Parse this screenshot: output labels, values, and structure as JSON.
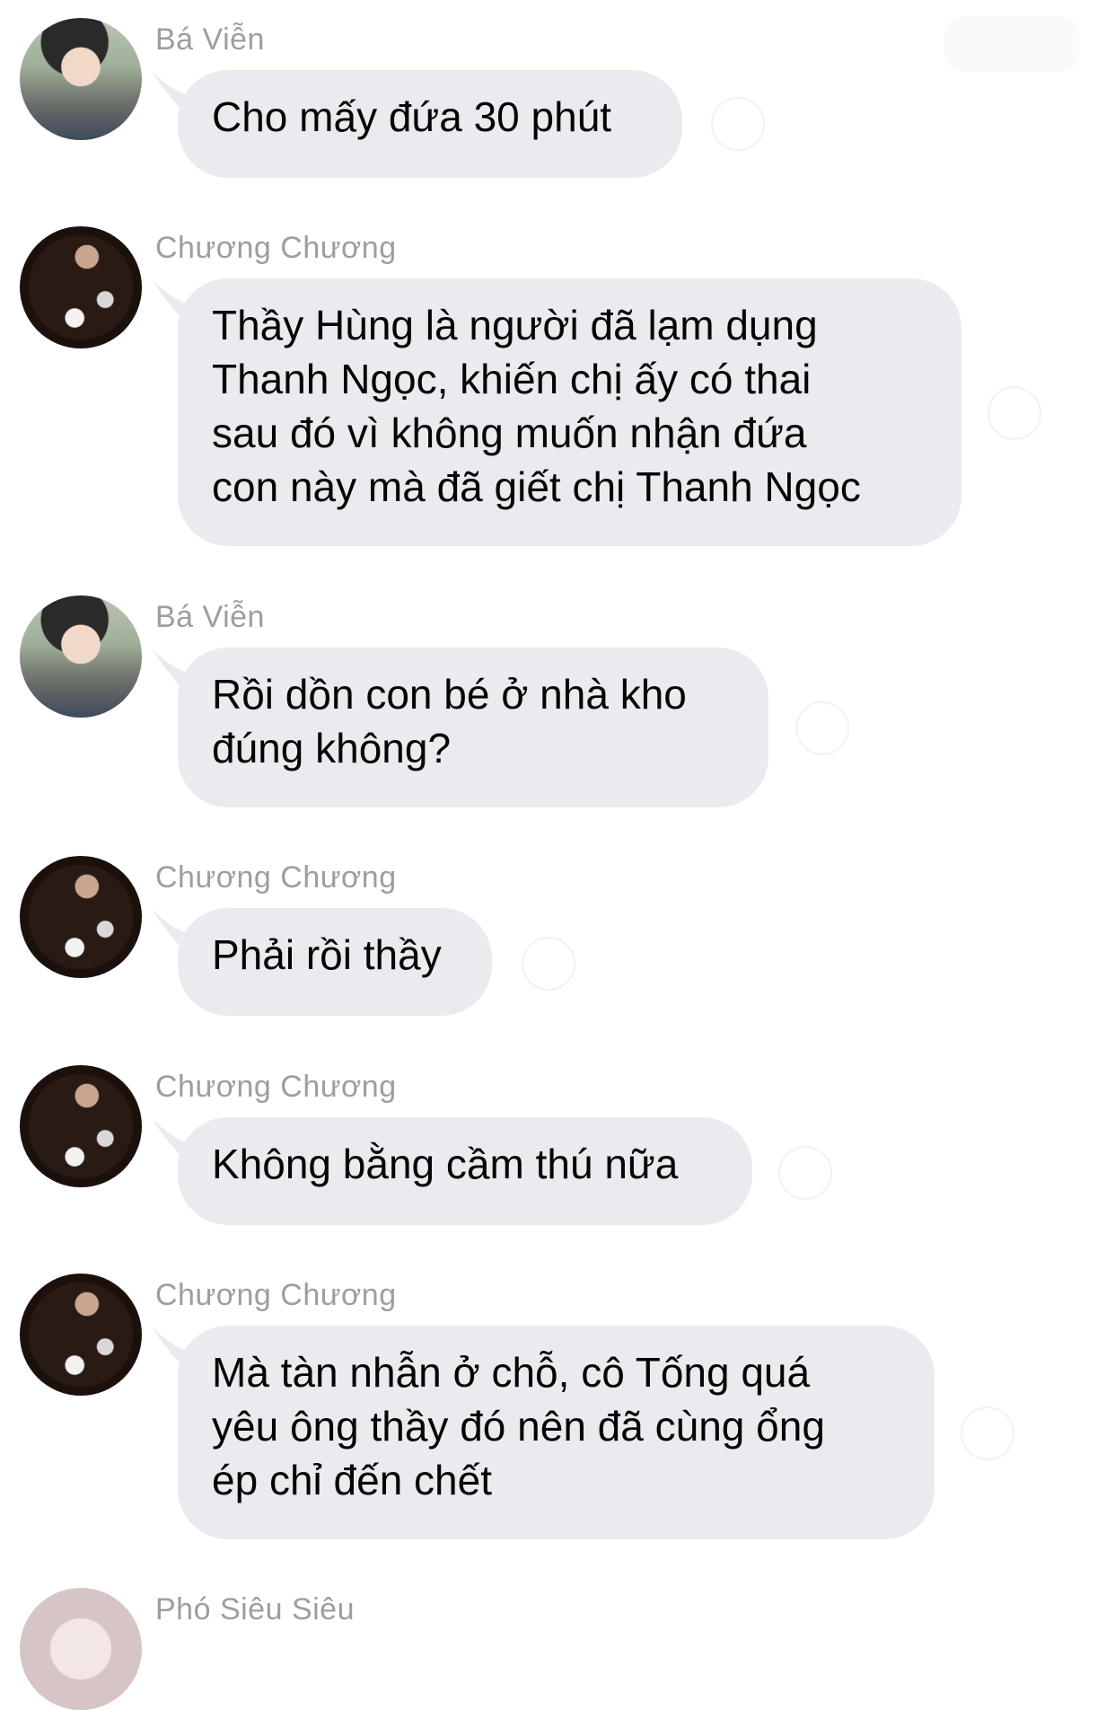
{
  "messages": [
    {
      "sender": "Bá Viễn",
      "avatar": "avatar-ba-vien",
      "lines": [
        "Cho mấy đứa 30 phút"
      ]
    },
    {
      "sender": "Chương Chương",
      "avatar": "avatar-chuong-chuong",
      "lines": [
        "Thầy Hùng là người đã lạm dụng",
        "Thanh Ngọc, khiến chị ấy có thai",
        "sau đó vì không muốn nhận đứa",
        "con này mà đã giết chị Thanh Ngọc"
      ]
    },
    {
      "sender": "Bá Viễn",
      "avatar": "avatar-ba-vien",
      "lines": [
        "Rồi dồn con bé ở nhà kho",
        "đúng không?"
      ]
    },
    {
      "sender": "Chương Chương",
      "avatar": "avatar-chuong-chuong",
      "lines": [
        "Phải rồi thầy"
      ]
    },
    {
      "sender": "Chương Chương",
      "avatar": "avatar-chuong-chuong",
      "lines": [
        "Không bằng cầm thú nữa"
      ]
    },
    {
      "sender": "Chương Chương",
      "avatar": "avatar-chuong-chuong",
      "lines": [
        "Mà tàn nhẫn ở chỗ, cô Tống quá",
        "yêu ông thầy đó nên đã cùng ổng",
        "ép chỉ đến chết"
      ]
    },
    {
      "sender": "Phó Siêu Siêu",
      "avatar": "avatar-pho-sieu-sieu",
      "lines": []
    }
  ],
  "colors": {
    "bubble": "#e9ebee",
    "sender_name": "#9b9ea3",
    "text": "#050505"
  }
}
